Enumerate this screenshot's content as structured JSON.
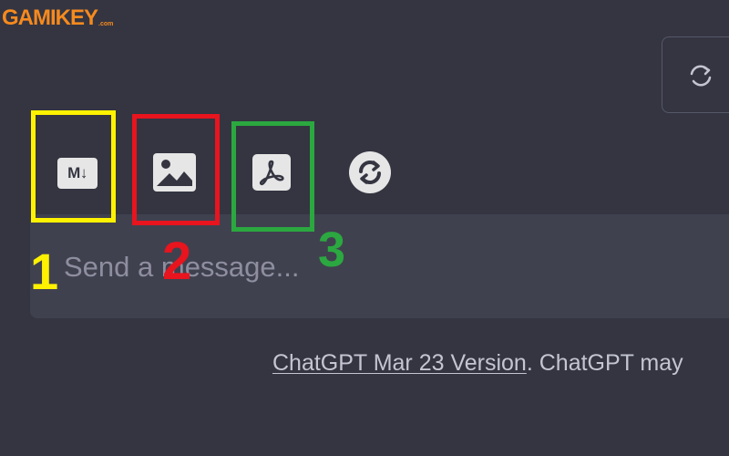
{
  "watermark": {
    "brand": "GAMIKEY",
    "suffix": ".com",
    "color": "#f68a1e"
  },
  "toolbar": {
    "markdown_label": "M↓",
    "items": [
      {
        "icon": "markdown-icon",
        "marker": "1",
        "marker_color": "#fff200"
      },
      {
        "icon": "image-icon",
        "marker": "2",
        "marker_color": "#e8141e"
      },
      {
        "icon": "pdf-icon",
        "marker": "3",
        "marker_color": "#2ba840"
      },
      {
        "icon": "refresh-icon"
      }
    ]
  },
  "input": {
    "placeholder": "Send a message..."
  },
  "footer": {
    "version_link": "ChatGPT Mar 23 Version",
    "rest": ". ChatGPT may"
  },
  "colors": {
    "background": "#343541",
    "input_bg": "#40414f",
    "icon_bg": "#e6e6e6"
  }
}
